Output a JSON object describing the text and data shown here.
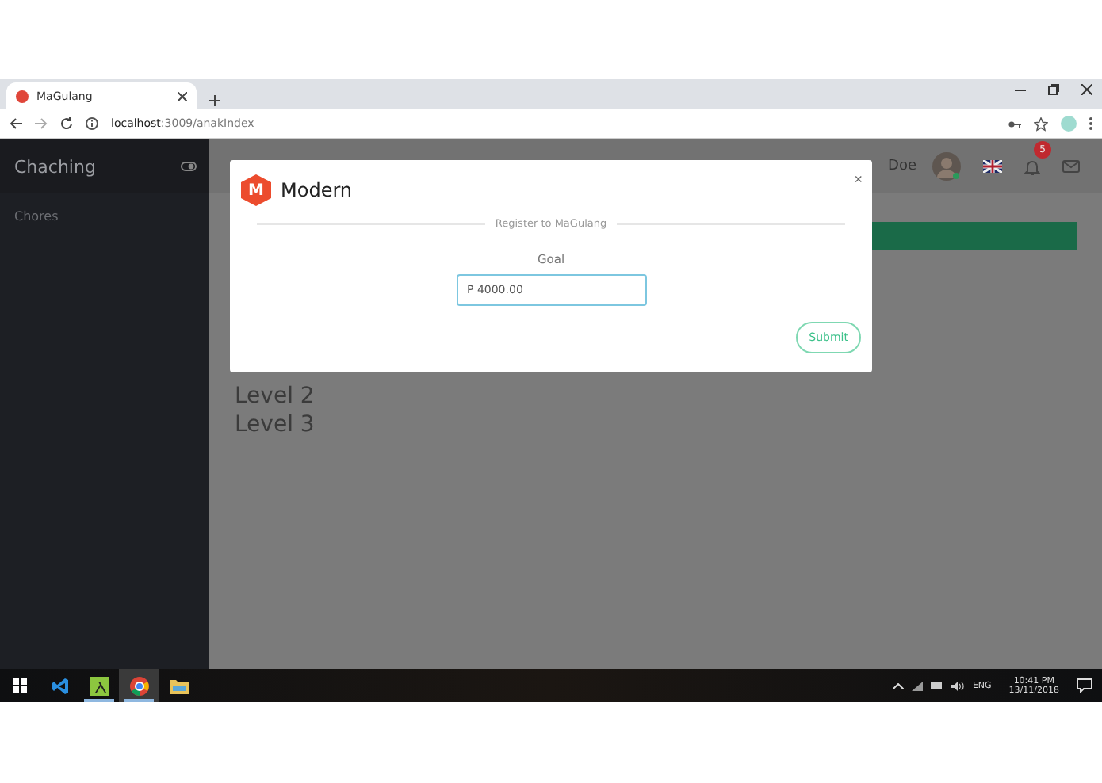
{
  "browser": {
    "tab": {
      "title": "MaGulang",
      "selected": true
    },
    "address": {
      "host": "localhost",
      "path": ":3009/anakIndex"
    }
  },
  "sidebar": {
    "brand": "Chaching",
    "items": [
      {
        "label": "Chores",
        "selected": false
      }
    ]
  },
  "header": {
    "user_name": "Doe",
    "notification_count": "5"
  },
  "levels": [
    "Level 2",
    "Level 3"
  ],
  "modal": {
    "logo_letter": "M",
    "title": "Modern",
    "close": "×",
    "divider_text": "Register to MaGulang",
    "field_label": "Goal",
    "field_value": "P 4000.00",
    "submit": "Submit"
  },
  "taskbar": {
    "apps": [
      {
        "kind": "vscode",
        "open": false,
        "selected": false
      },
      {
        "kind": "lambda",
        "open": true,
        "selected": false
      },
      {
        "kind": "chrome",
        "open": true,
        "selected": true
      },
      {
        "kind": "folder",
        "open": false,
        "selected": false
      }
    ],
    "language": "ENG",
    "time": "10:41 PM",
    "date": "13/11/2018"
  }
}
